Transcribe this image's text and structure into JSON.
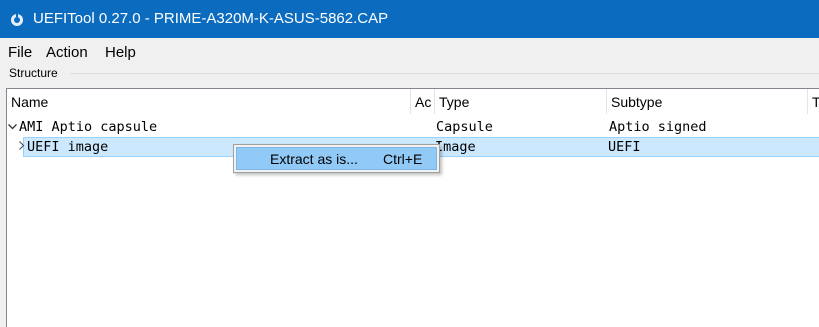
{
  "window": {
    "title": "UEFITool 0.27.0 - PRIME-A320M-K-ASUS-5862.CAP",
    "titlebar_color": "#0b6cbf"
  },
  "menu": {
    "items": [
      {
        "label": "File"
      },
      {
        "label": "Action"
      },
      {
        "label": "Help"
      }
    ]
  },
  "structure": {
    "label": "Structure"
  },
  "tree": {
    "columns": [
      {
        "label": "Name"
      },
      {
        "label": "Ac"
      },
      {
        "label": "Type"
      },
      {
        "label": "Subtype"
      },
      {
        "label": "T"
      }
    ],
    "rows": [
      {
        "name": "AMI Aptio capsule",
        "type": "Capsule",
        "subtype": "Aptio signed",
        "expander_icon": "chevron-down-icon",
        "selected": false
      },
      {
        "name": "UEFI image",
        "type": "Image",
        "subtype": "UEFI",
        "expander_icon": "chevron-right-icon",
        "selected": true
      }
    ],
    "selection_color": "#cce8ff"
  },
  "context_menu": {
    "items": [
      {
        "label": "Extract as is...",
        "shortcut": "Ctrl+E",
        "highlighted": true
      }
    ],
    "highlight_color": "#91c9f7"
  }
}
